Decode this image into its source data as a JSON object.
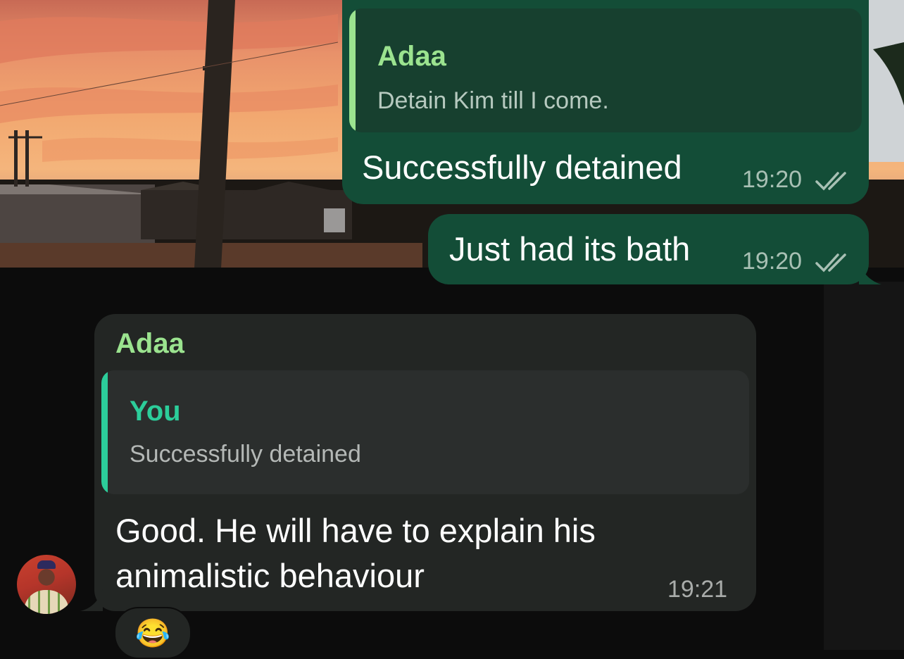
{
  "messages": [
    {
      "direction": "outgoing",
      "quote": {
        "author": "Adaa",
        "text": "Detain Kim till I come."
      },
      "text": "Successfully detained",
      "time": "19:20",
      "status": "read-double-tick-icon"
    },
    {
      "direction": "outgoing",
      "text": "Just had its bath",
      "time": "19:20",
      "status": "read-double-tick-icon"
    },
    {
      "direction": "incoming",
      "sender": "Adaa",
      "quote": {
        "author": "You",
        "text": "Successfully detained"
      },
      "text_lines": [
        "Good. He will have to explain his",
        "animalistic behaviour"
      ],
      "time": "19:21",
      "reaction": "😂"
    }
  ],
  "colors": {
    "outgoing_bubble": "#134d37",
    "incoming_bubble": "#232624",
    "quote_name_adaa": "#9be38f",
    "quote_name_you": "#2ccd9a"
  },
  "icons": {
    "avatar": "contact-avatar",
    "ticks": "double-tick-icon"
  }
}
